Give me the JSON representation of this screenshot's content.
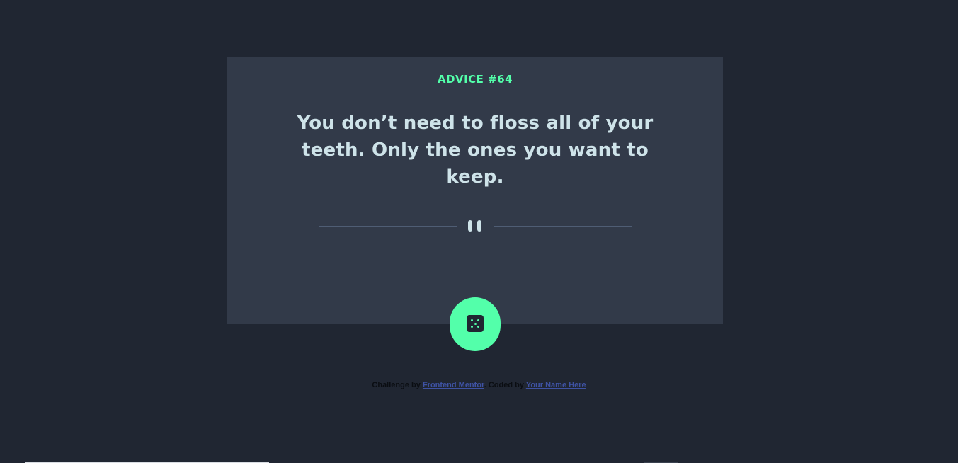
{
  "advice": {
    "id_label": "ADVICE #64",
    "text": "You don’t need to floss all of your teeth. Only the ones you want to keep."
  },
  "dice_button": {
    "icon": "dice-icon",
    "aria_label": "Get new advice"
  },
  "attribution": {
    "challenge_prefix": "Challenge by",
    "challenge_link": "Frontend Mentor",
    "coded_prefix": ". Coded by",
    "author_link": "Your Name Here"
  },
  "colors": {
    "background": "#202632",
    "card": "#323a49",
    "accent": "#53ffaa",
    "text": "#cee3e9",
    "divider": "#4f5d74",
    "link": "#3e52a3"
  }
}
